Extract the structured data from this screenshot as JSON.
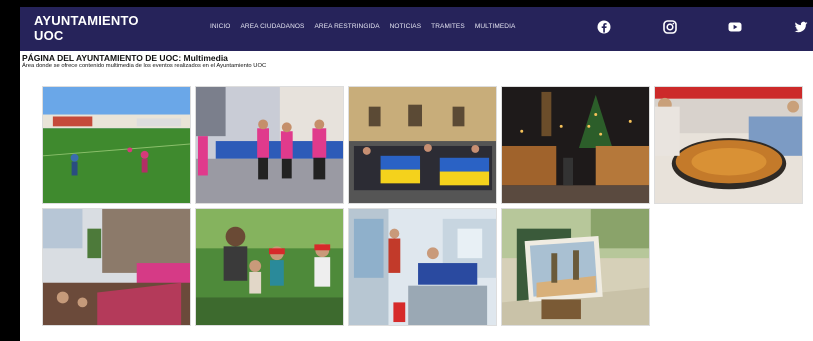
{
  "header": {
    "logo_line1": "AYUNTAMIENTO",
    "logo_line2": "UOC",
    "nav": [
      "INICIO",
      "AREA CIUDADANOS",
      "AREA RESTRINGIDA",
      "NOTICIAS",
      "TRAMITES",
      "MULTIMEDIA"
    ],
    "social_icons": [
      "facebook-icon",
      "instagram-icon",
      "youtube-icon",
      "twitter-icon"
    ],
    "bg_color": "#26235a"
  },
  "page": {
    "heading": "PÁGINA DEL AYUNTAMIENTO DE UOC: Multimedia",
    "description": "Área donde se ofrece contenido multimedia de los eventos realizados en el Ayuntamiento UOC"
  },
  "gallery": [
    {
      "subject": "soccer-match-photo"
    },
    {
      "subject": "women-running-race-photo"
    },
    {
      "subject": "people-with-ukraine-flags-photo"
    },
    {
      "subject": "christmas-market-night-photo"
    },
    {
      "subject": "giant-paella-cooking-photo"
    },
    {
      "subject": "street-parade-float-photo"
    },
    {
      "subject": "children-garden-photo"
    },
    {
      "subject": "ambulance-interior-photo"
    },
    {
      "subject": "painting-on-easel-park-photo"
    }
  ]
}
